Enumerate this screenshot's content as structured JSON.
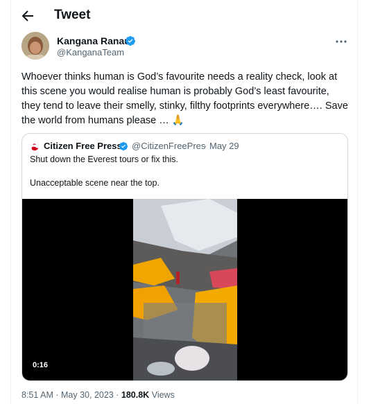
{
  "header": {
    "title": "Tweet"
  },
  "author": {
    "name": "Kangana Ranaut",
    "handle": "@KanganaTeam",
    "verified": true,
    "verified_color": "#1d9bf0"
  },
  "tweet": {
    "text": "Whoever thinks human is God’s favourite needs a reality check, look at this scene you would realise human is probably God’s least favourite, they tend to leave their smelly, stinky, filthy footprints everywhere…. Save the world from humans please … 🙏"
  },
  "quote": {
    "name": "Citizen Free Press",
    "handle": "@CitizenFreePres",
    "separator": "·",
    "date": "May 29",
    "line1": "Shut down the Everest tours or fix this.",
    "line2": "Unacceptable scene near the top.",
    "video": {
      "duration": "0:16"
    }
  },
  "meta": {
    "time": "8:51 AM",
    "date": "May 30, 2023",
    "views_count": "180.8K",
    "views_label": "Views",
    "dot": "·"
  },
  "icons": {
    "back": "arrow-left-icon",
    "more": "more-horizontal-icon",
    "verified": "verified-badge-icon",
    "quote_avatar": "rocket-icon"
  }
}
